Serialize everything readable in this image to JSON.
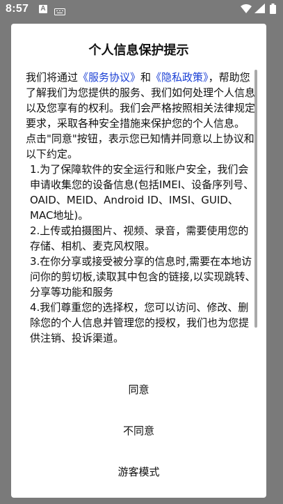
{
  "status_bar": {
    "time": "8:57",
    "notification_letter": "A",
    "icons": [
      "a-notification-icon",
      "keyboard-icon",
      "wifi-icon",
      "signal-icon",
      "battery-icon"
    ],
    "color": "#ffffff"
  },
  "dialog": {
    "title": "个人信息保护提示",
    "intro": {
      "text_before": "我们将通过",
      "link_service": "《服务协议》",
      "text_and": "和",
      "link_privacy": "《隐私政策》",
      "text_after": "，帮助您了解我们为您提供的服务、我们如何处理个人信息以及您享有的权利。我们会严格按照相关法律规定要求，采取各种安全措施来保护您的个人信息。"
    },
    "click_note": "点击\"同意\"按钮，表示您已知情并同意以上协议和以下约定。",
    "items": [
      "1.为了保障软件的安全运行和账户安全，我们会申请收集您的设备信息(包括IMEI、设备序列号、OAID、MEID、Android ID、IMSI、GUID、MAC地址)。",
      "2.上传或拍摄图片、视频、录音，需要使用您的存储、相机、麦克风权限。",
      "3.在你分享或接受被分享的信息时,需要在本地访问你的剪切板,读取其中包含的链接,以实现跳转、分享等功能和服务",
      "4.我们尊重您的选择权，您可以访问、修改、删除您的个人信息并管理您的授权，我们也为您提供注销、投诉渠道。"
    ],
    "link_color": "#1a3fd4",
    "buttons": {
      "agree": "同意",
      "disagree": "不同意",
      "guest": "游客模式"
    }
  }
}
